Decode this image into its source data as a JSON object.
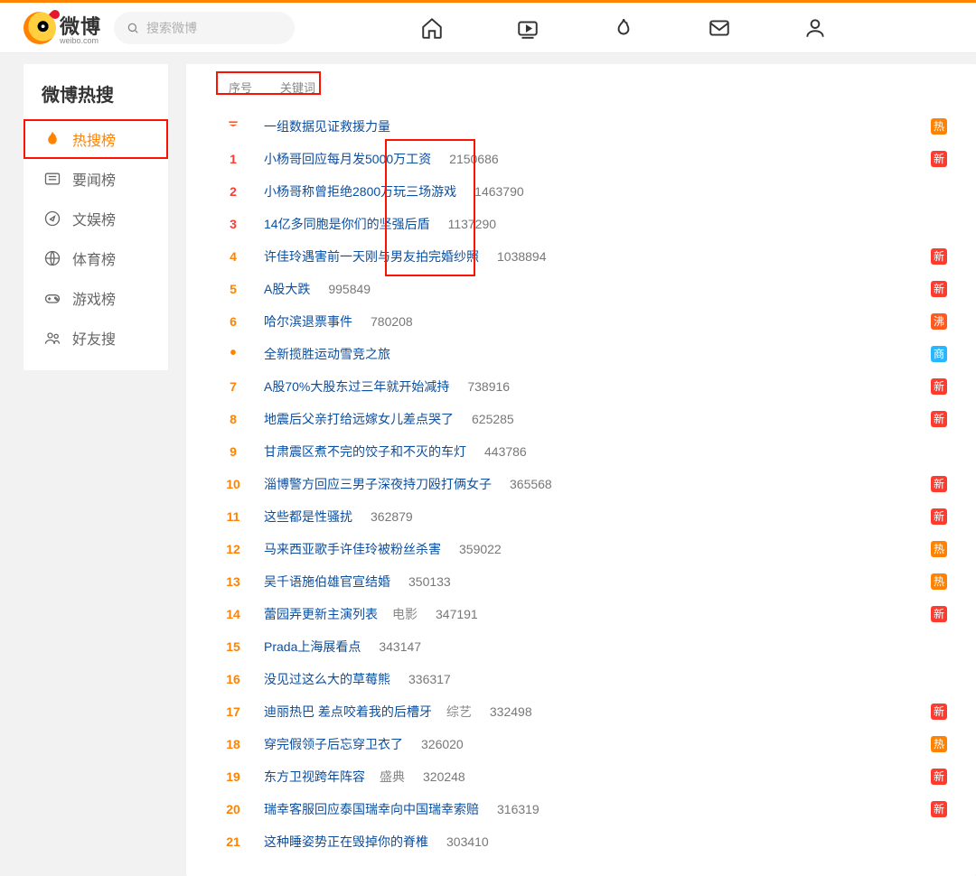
{
  "search": {
    "placeholder": "搜索微博"
  },
  "logo": {
    "text": "微博",
    "sub": "weibo.com"
  },
  "sidebar": {
    "title": "微博热搜",
    "items": [
      {
        "label": "热搜榜",
        "active": true
      },
      {
        "label": "要闻榜",
        "active": false
      },
      {
        "label": "文娱榜",
        "active": false
      },
      {
        "label": "体育榜",
        "active": false
      },
      {
        "label": "游戏榜",
        "active": false
      },
      {
        "label": "好友搜",
        "active": false
      }
    ]
  },
  "table": {
    "header_idx": "序号",
    "header_kw": "关键词"
  },
  "tag_labels": {
    "hot": "热",
    "new": "新",
    "boil": "沸",
    "biz": "商"
  },
  "rows": [
    {
      "rank": "top",
      "kw": "一组数据见证救援力量",
      "count": "",
      "extra": "",
      "tag": "hot"
    },
    {
      "rank": "1",
      "kw": "小杨哥回应每月发5000万工资",
      "count": "2150686",
      "extra": "",
      "tag": "new"
    },
    {
      "rank": "2",
      "kw": "小杨哥称曾拒绝2800万玩三场游戏",
      "count": "1463790",
      "extra": "",
      "tag": ""
    },
    {
      "rank": "3",
      "kw": "14亿多同胞是你们的坚强后盾",
      "count": "1137290",
      "extra": "",
      "tag": ""
    },
    {
      "rank": "4",
      "kw": "许佳玲遇害前一天刚与男友拍完婚纱照",
      "count": "1038894",
      "extra": "",
      "tag": "new"
    },
    {
      "rank": "5",
      "kw": "A股大跌",
      "count": "995849",
      "extra": "",
      "tag": "new"
    },
    {
      "rank": "6",
      "kw": "哈尔滨退票事件",
      "count": "780208",
      "extra": "",
      "tag": "boil"
    },
    {
      "rank": "dot",
      "kw": "全新揽胜运动雪竞之旅",
      "count": "",
      "extra": "",
      "tag": "biz"
    },
    {
      "rank": "7",
      "kw": "A股70%大股东过三年就开始减持",
      "count": "738916",
      "extra": "",
      "tag": "new"
    },
    {
      "rank": "8",
      "kw": "地震后父亲打给远嫁女儿差点哭了",
      "count": "625285",
      "extra": "",
      "tag": "new"
    },
    {
      "rank": "9",
      "kw": "甘肃震区煮不完的饺子和不灭的车灯",
      "count": "443786",
      "extra": "",
      "tag": ""
    },
    {
      "rank": "10",
      "kw": "淄博警方回应三男子深夜持刀殴打俩女子",
      "count": "365568",
      "extra": "",
      "tag": "new"
    },
    {
      "rank": "11",
      "kw": "这些都是性骚扰",
      "count": "362879",
      "extra": "",
      "tag": "new"
    },
    {
      "rank": "12",
      "kw": "马来西亚歌手许佳玲被粉丝杀害",
      "count": "359022",
      "extra": "",
      "tag": "hot"
    },
    {
      "rank": "13",
      "kw": "吴千语施伯雄官宣结婚",
      "count": "350133",
      "extra": "",
      "tag": "hot"
    },
    {
      "rank": "14",
      "kw": "蕾园弄更新主演列表",
      "count": "347191",
      "extra": "电影",
      "tag": "new"
    },
    {
      "rank": "15",
      "kw": "Prada上海展看点",
      "count": "343147",
      "extra": "",
      "tag": ""
    },
    {
      "rank": "16",
      "kw": "没见过这么大的草莓熊",
      "count": "336317",
      "extra": "",
      "tag": ""
    },
    {
      "rank": "17",
      "kw": "迪丽热巴 差点咬着我的后槽牙",
      "count": "332498",
      "extra": "综艺",
      "tag": "new"
    },
    {
      "rank": "18",
      "kw": "穿完假领子后忘穿卫衣了",
      "count": "326020",
      "extra": "",
      "tag": "hot"
    },
    {
      "rank": "19",
      "kw": "东方卫视跨年阵容",
      "count": "320248",
      "extra": "盛典",
      "tag": "new"
    },
    {
      "rank": "20",
      "kw": "瑞幸客服回应泰国瑞幸向中国瑞幸索赔",
      "count": "316319",
      "extra": "",
      "tag": "new"
    },
    {
      "rank": "21",
      "kw": "这种睡姿势正在毁掉你的脊椎",
      "count": "303410",
      "extra": "",
      "tag": ""
    }
  ]
}
